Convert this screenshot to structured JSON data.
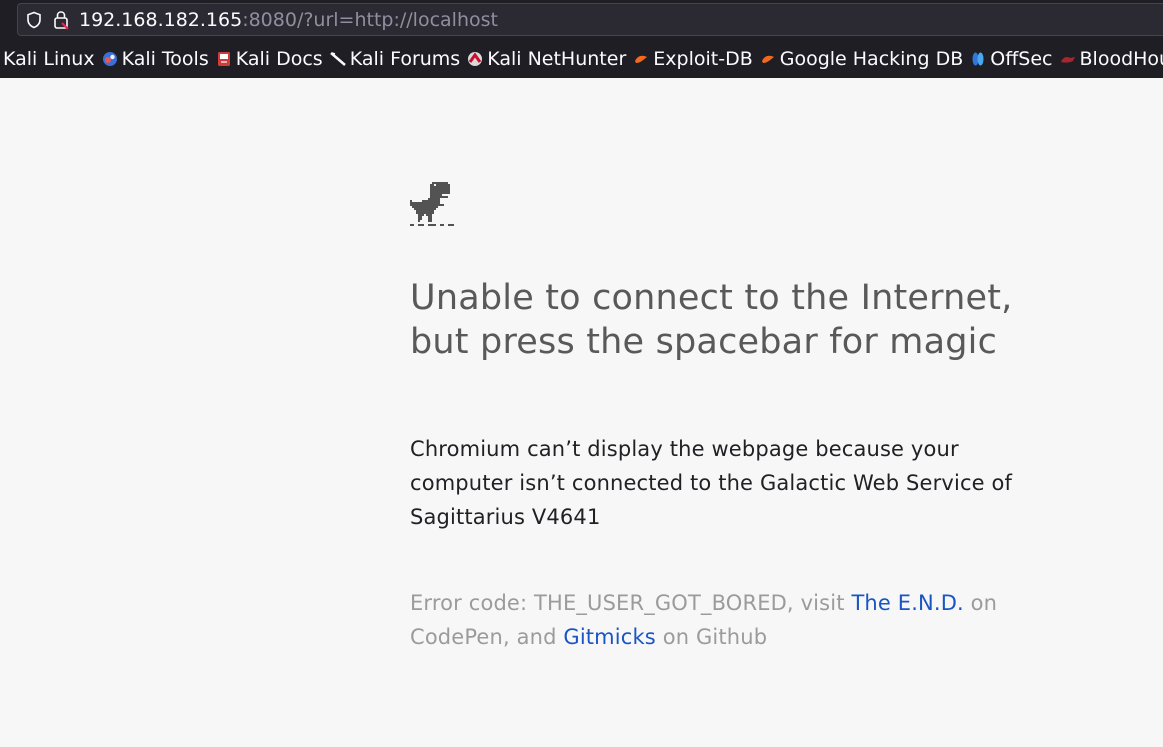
{
  "browser": {
    "url_host": "192.168.182.165",
    "url_rest": ":8080/?url=http://localhost",
    "bookmarks": [
      {
        "label": "Kali Linux",
        "icon": "kali-linux-icon"
      },
      {
        "label": "Kali Tools",
        "icon": "kali-tools-icon"
      },
      {
        "label": "Kali Docs",
        "icon": "kali-docs-icon"
      },
      {
        "label": "Kali Forums",
        "icon": "kali-forums-icon"
      },
      {
        "label": "Kali NetHunter",
        "icon": "kali-nethunter-icon"
      },
      {
        "label": "Exploit-DB",
        "icon": "exploit-db-icon"
      },
      {
        "label": "Google Hacking DB",
        "icon": "google-hacking-db-icon"
      },
      {
        "label": "OffSec",
        "icon": "offsec-icon"
      },
      {
        "label": "BloodHound",
        "icon": "bloodhound-icon"
      }
    ]
  },
  "page": {
    "headline": "Unable to connect to the Internet, but press the spacebar for magic",
    "description": "Chromium can’t display the webpage because your computer isn’t connected to the Galactic Web Service of Sagittarius V4641",
    "error_prefix": "Error code: THE_USER_GOT_BORED, visit ",
    "link1": "The E.N.D.",
    "error_middle": " on CodePen, and ",
    "link2": "Gitmicks",
    "error_suffix": " on Github"
  },
  "colors": {
    "chrome_bg": "#1f1e25",
    "page_bg": "#f7f7f7",
    "link": "#1a55c4",
    "headline": "#595959"
  }
}
